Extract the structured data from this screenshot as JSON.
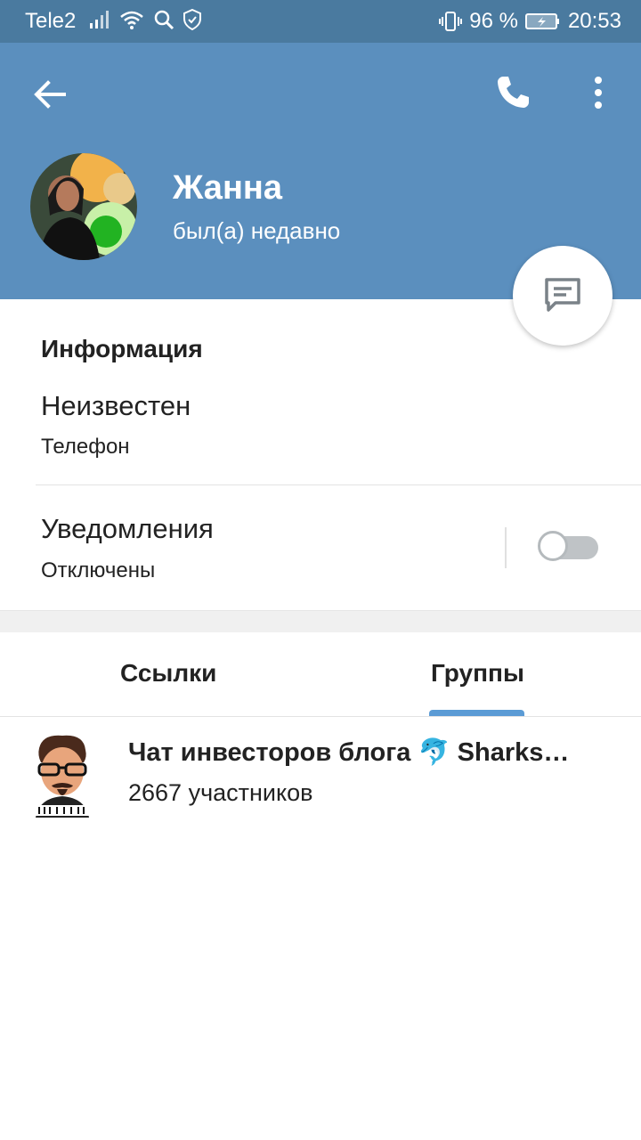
{
  "status_bar": {
    "carrier": "Tele2",
    "battery": "96 %",
    "time": "20:53"
  },
  "header": {
    "name": "Жанна",
    "status": "был(а) недавно"
  },
  "info": {
    "section_title": "Информация",
    "phone_value": "Неизвестен",
    "phone_label": "Телефон",
    "notifications_title": "Уведомления",
    "notifications_value": "Отключены",
    "notifications_enabled": false
  },
  "tabs": [
    {
      "label": "Ссылки",
      "active": false
    },
    {
      "label": "Группы",
      "active": true
    }
  ],
  "groups": [
    {
      "title": "Чат инвесторов блога 🐬 Sharks…",
      "subtitle": "2667 участников"
    }
  ],
  "colors": {
    "header_bg": "#5b8fbe",
    "statusbar_bg": "#4a7a9f",
    "accent": "#5b9bd5"
  }
}
